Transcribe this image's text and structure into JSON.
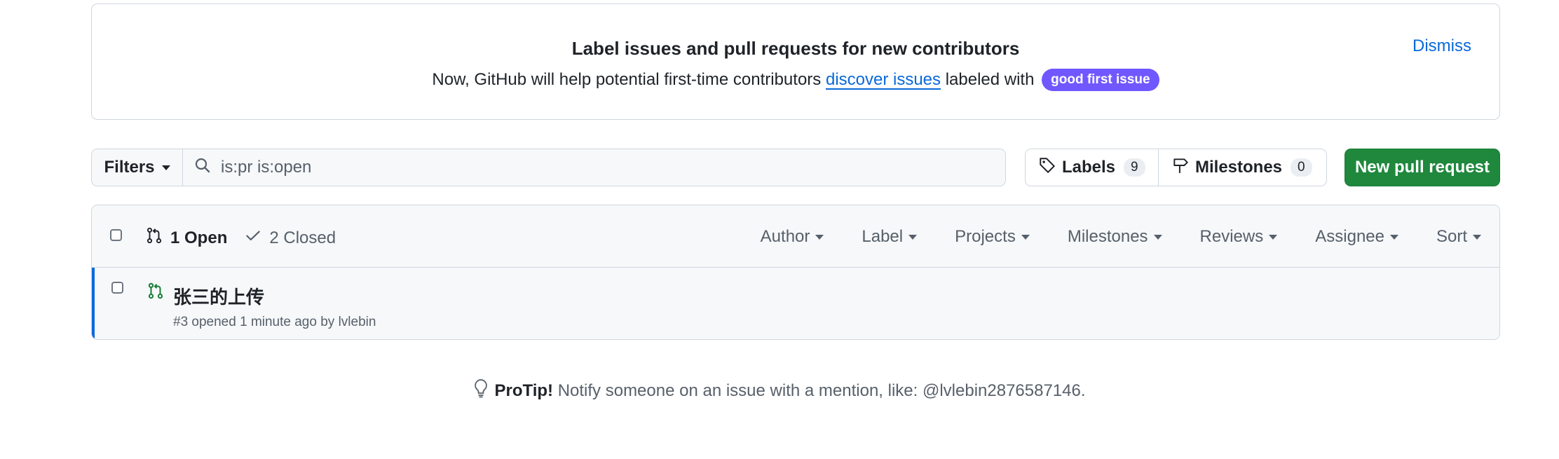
{
  "banner": {
    "title": "Label issues and pull requests for new contributors",
    "text_before": "Now, GitHub will help potential first-time contributors ",
    "link": "discover issues",
    "text_after": " labeled with ",
    "badge": "good first issue",
    "dismiss": "Dismiss"
  },
  "toolbar": {
    "filters_label": "Filters",
    "search_value": "is:pr is:open",
    "labels_label": "Labels",
    "labels_count": "9",
    "milestones_label": "Milestones",
    "milestones_count": "0",
    "new_pr_label": "New pull request"
  },
  "list": {
    "open_label": "1 Open",
    "closed_label": "2 Closed",
    "filters": [
      "Author",
      "Label",
      "Projects",
      "Milestones",
      "Reviews",
      "Assignee",
      "Sort"
    ],
    "items": [
      {
        "title": "张三的上传",
        "meta_prefix": "#3 opened 1 minute ago by ",
        "author": "lvlebin"
      }
    ]
  },
  "protip": {
    "bold": "ProTip!",
    "text": "Notify someone on an issue with a mention, like: @lvlebin2876587146."
  },
  "colors": {
    "accent": "#0969da",
    "primary_button": "#1f883d",
    "badge": "#7057ff",
    "open_icon": "#1a7f37"
  }
}
